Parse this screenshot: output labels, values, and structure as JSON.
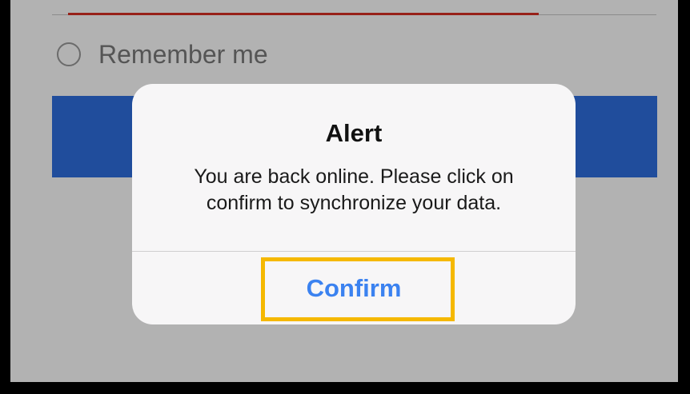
{
  "form": {
    "remember_label": "Remember me"
  },
  "alert": {
    "title": "Alert",
    "message": "You are back online. Please click on confirm to synchronize your data.",
    "confirm_label": "Confirm"
  },
  "colors": {
    "primary_button": "#2f6fe0",
    "error_underline": "#d93025",
    "confirm_text": "#3b82f0",
    "highlight": "#f5b800"
  }
}
